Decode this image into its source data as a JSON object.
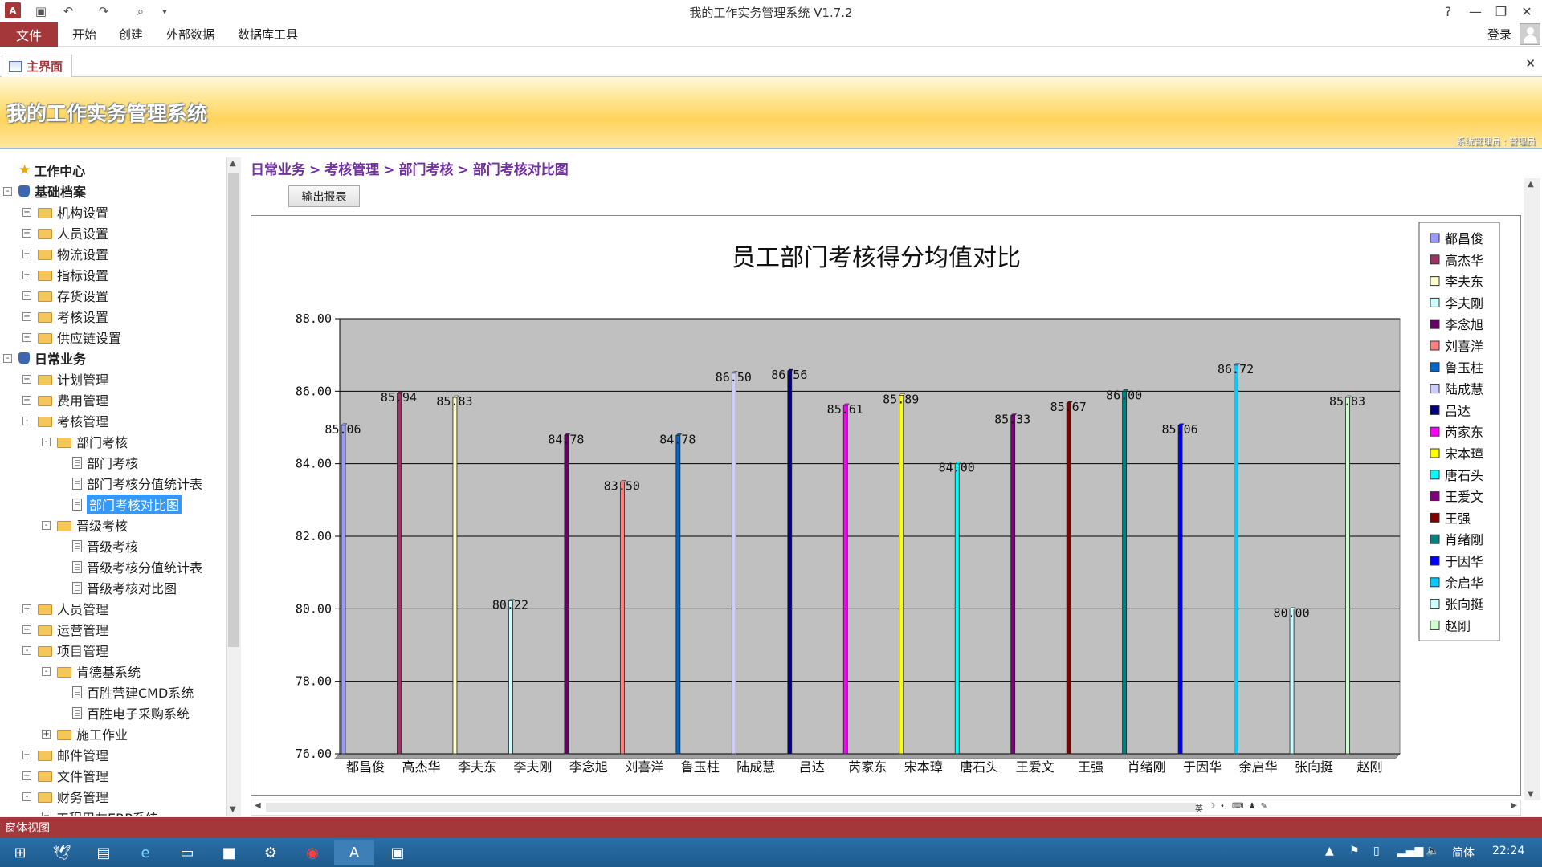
{
  "app": {
    "title": "我的工作实务管理系统 V1.7.2",
    "header_title": "我的工作实务管理系统",
    "header_user": "系统管理员 : 管理员",
    "login": "登录"
  },
  "ribbon": {
    "file": "文件",
    "tabs": [
      "开始",
      "创建",
      "外部数据",
      "数据库工具"
    ]
  },
  "doc_tab": "主界面",
  "tree": [
    {
      "label": "工作中心",
      "level": 0,
      "kind": "star",
      "bold": true
    },
    {
      "label": "基础档案",
      "level": 0,
      "kind": "db",
      "bold": true,
      "exp": "-"
    },
    {
      "label": "机构设置",
      "level": 1,
      "kind": "folder",
      "exp": "+"
    },
    {
      "label": "人员设置",
      "level": 1,
      "kind": "folder",
      "exp": "+"
    },
    {
      "label": "物流设置",
      "level": 1,
      "kind": "folder",
      "exp": "+"
    },
    {
      "label": "指标设置",
      "level": 1,
      "kind": "folder",
      "exp": "+"
    },
    {
      "label": "存货设置",
      "level": 1,
      "kind": "folder",
      "exp": "+"
    },
    {
      "label": "考核设置",
      "level": 1,
      "kind": "folder",
      "exp": "+"
    },
    {
      "label": "供应链设置",
      "level": 1,
      "kind": "folder",
      "exp": "+"
    },
    {
      "label": "日常业务",
      "level": 0,
      "kind": "db",
      "bold": true,
      "exp": "-"
    },
    {
      "label": "计划管理",
      "level": 1,
      "kind": "folder",
      "exp": "+"
    },
    {
      "label": "费用管理",
      "level": 1,
      "kind": "folder",
      "exp": "+"
    },
    {
      "label": "考核管理",
      "level": 1,
      "kind": "folder",
      "exp": "-"
    },
    {
      "label": "部门考核",
      "level": 2,
      "kind": "folder",
      "exp": "-"
    },
    {
      "label": "部门考核",
      "level": 3,
      "kind": "doc"
    },
    {
      "label": "部门考核分值统计表",
      "level": 3,
      "kind": "doc"
    },
    {
      "label": "部门考核对比图",
      "level": 3,
      "kind": "doc",
      "selected": true
    },
    {
      "label": "晋级考核",
      "level": 2,
      "kind": "folder",
      "exp": "-"
    },
    {
      "label": "晋级考核",
      "level": 3,
      "kind": "doc"
    },
    {
      "label": "晋级考核分值统计表",
      "level": 3,
      "kind": "doc"
    },
    {
      "label": "晋级考核对比图",
      "level": 3,
      "kind": "doc"
    },
    {
      "label": "人员管理",
      "level": 1,
      "kind": "folder",
      "exp": "+"
    },
    {
      "label": "运营管理",
      "level": 1,
      "kind": "folder",
      "exp": "+"
    },
    {
      "label": "项目管理",
      "level": 1,
      "kind": "folder",
      "exp": "-"
    },
    {
      "label": "肯德基系统",
      "level": 2,
      "kind": "folder",
      "exp": "-"
    },
    {
      "label": "百胜营建CMD系统",
      "level": 3,
      "kind": "doc"
    },
    {
      "label": "百胜电子采购系统",
      "level": 3,
      "kind": "doc"
    },
    {
      "label": "施工作业",
      "level": 2,
      "kind": "folder",
      "exp": "+"
    },
    {
      "label": "邮件管理",
      "level": 1,
      "kind": "folder",
      "exp": "+"
    },
    {
      "label": "文件管理",
      "level": 1,
      "kind": "folder",
      "exp": "+"
    },
    {
      "label": "财务管理",
      "level": 1,
      "kind": "folder",
      "exp": "-"
    },
    {
      "label": "工程用友ERP系统",
      "level": 2,
      "kind": "doc"
    }
  ],
  "breadcrumb": [
    "日常业务",
    "考核管理",
    "部门考核",
    "部门考核对比图"
  ],
  "export_button": "输出报表",
  "status_text": "窗体视图",
  "taskbar": {
    "ime": "简体",
    "time": "22:24"
  },
  "chart_data": {
    "type": "bar",
    "title": "员工部门考核得分均值对比",
    "categories": [
      "都昌俊",
      "高杰华",
      "李夫东",
      "李夫刚",
      "李念旭",
      "刘喜洋",
      "鲁玉柱",
      "陆成慧",
      "吕达",
      "芮家东",
      "宋本璋",
      "唐石头",
      "王爱文",
      "王强",
      "肖绪刚",
      "于因华",
      "余启华",
      "张向挺",
      "赵刚"
    ],
    "values": [
      85.06,
      85.94,
      85.83,
      80.22,
      84.78,
      83.5,
      84.78,
      86.5,
      86.56,
      85.61,
      85.89,
      84.0,
      85.33,
      85.67,
      86.0,
      85.06,
      86.72,
      80.0,
      85.83
    ],
    "value_labels": [
      "85.06",
      "85.94",
      "85.83",
      "80.22",
      "84.78",
      "83.50",
      "84.78",
      "86.50",
      "86.56",
      "85.61",
      "85.89",
      "84.00",
      "85.33",
      "85.67",
      "86.00",
      "85.06",
      "86.72",
      "80.00",
      "85.83"
    ],
    "colors": [
      "#9999ff",
      "#993366",
      "#ffffcc",
      "#ccffff",
      "#660066",
      "#ff8080",
      "#0066cc",
      "#ccccff",
      "#000080",
      "#ff00ff",
      "#ffff00",
      "#00ffff",
      "#800080",
      "#800000",
      "#008080",
      "#0000ff",
      "#00ccff",
      "#ccffff",
      "#ccffcc"
    ],
    "yticks": [
      "76.00",
      "78.00",
      "80.00",
      "82.00",
      "84.00",
      "86.00",
      "88.00"
    ],
    "ylim": [
      76,
      88
    ],
    "grid": true,
    "legend": "right"
  }
}
